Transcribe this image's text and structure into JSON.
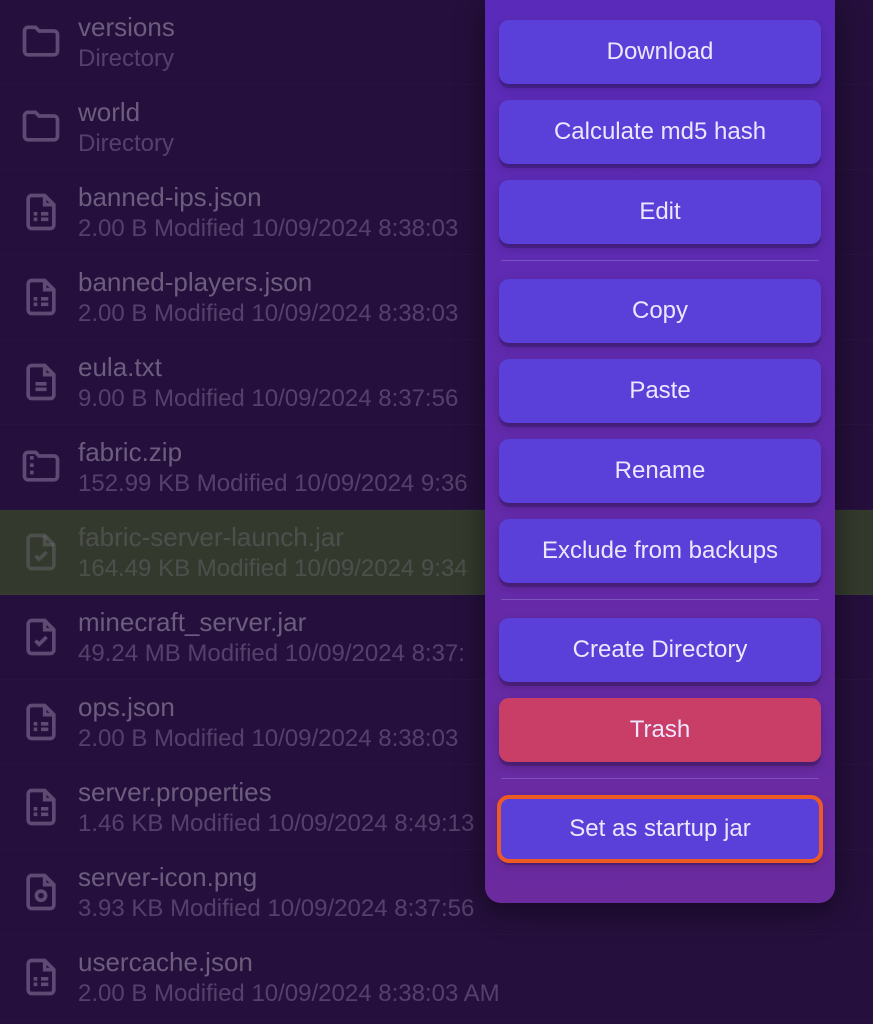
{
  "files": [
    {
      "name": "versions",
      "meta": "Directory",
      "icon": "folder"
    },
    {
      "name": "world",
      "meta": "Directory",
      "icon": "folder"
    },
    {
      "name": "banned-ips.json",
      "meta": "2.00 B Modified 10/09/2024 8:38:03",
      "icon": "file-config"
    },
    {
      "name": "banned-players.json",
      "meta": "2.00 B Modified 10/09/2024 8:38:03",
      "icon": "file-config"
    },
    {
      "name": "eula.txt",
      "meta": "9.00 B Modified 10/09/2024 8:37:56",
      "icon": "file-text"
    },
    {
      "name": "fabric.zip",
      "meta": "152.99 KB Modified 10/09/2024 9:36",
      "icon": "file-zip"
    },
    {
      "name": "fabric-server-launch.jar",
      "meta": "164.49 KB Modified 10/09/2024 9:34",
      "icon": "file-exec",
      "selected": true
    },
    {
      "name": "minecraft_server.jar",
      "meta": "49.24 MB Modified 10/09/2024 8:37:",
      "icon": "file-exec"
    },
    {
      "name": "ops.json",
      "meta": "2.00 B Modified 10/09/2024 8:38:03",
      "icon": "file-config"
    },
    {
      "name": "server.properties",
      "meta": "1.46 KB Modified 10/09/2024 8:49:13",
      "icon": "file-config"
    },
    {
      "name": "server-icon.png",
      "meta": "3.93 KB Modified 10/09/2024 8:37:56",
      "icon": "file-image"
    },
    {
      "name": "usercache.json",
      "meta": "2.00 B Modified 10/09/2024 8:38:03 AM",
      "icon": "file-config"
    }
  ],
  "menu": {
    "download": "Download",
    "md5": "Calculate md5 hash",
    "edit": "Edit",
    "copy": "Copy",
    "paste": "Paste",
    "rename": "Rename",
    "exclude": "Exclude from backups",
    "create_dir": "Create Directory",
    "trash": "Trash",
    "set_startup": "Set as startup jar"
  },
  "colors": {
    "button": "#5a40d8",
    "danger": "#c83e66",
    "highlight": "#ee5a24",
    "selected_row": "#5a7a3a"
  }
}
